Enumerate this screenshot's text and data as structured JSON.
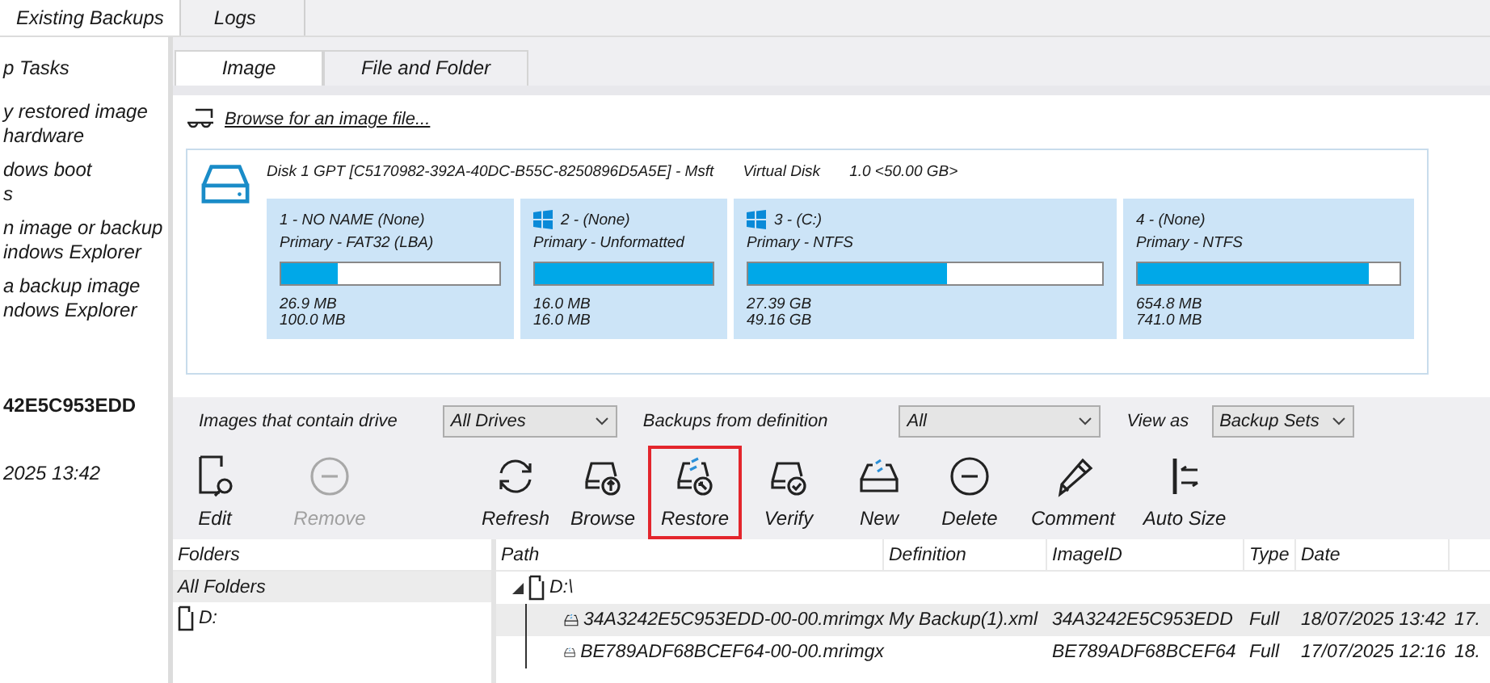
{
  "top_tabs": [
    {
      "label": "Existing Backups",
      "selected": true
    },
    {
      "label": "Logs",
      "selected": false
    }
  ],
  "left_panel": {
    "heading": "p Tasks",
    "tasks": [
      {
        "lines": [
          "y restored image",
          "hardware"
        ]
      },
      {
        "lines": [
          "dows boot",
          "s"
        ]
      },
      {
        "lines": [
          "n image or backup",
          "indows Explorer"
        ]
      },
      {
        "lines": [
          "a backup image",
          "ndows Explorer"
        ]
      }
    ],
    "image_id": "42E5C953EDD",
    "date": "2025 13:42"
  },
  "sub_tabs": [
    {
      "label": "Image",
      "selected": true
    },
    {
      "label": "File and Folder",
      "selected": false
    }
  ],
  "browse_link": "Browse for an image file...",
  "disk": {
    "title": "Disk 1 GPT [C5170982-392A-40DC-B55C-8250896D5A5E] - Msft",
    "type": "Virtual Disk",
    "size": "1.0  <50.00 GB>",
    "partitions": [
      {
        "name": "1 - NO NAME (None)",
        "fs": "Primary - FAT32 (LBA)",
        "os_icon": false,
        "level": 0.26,
        "used": "26.9 MB",
        "total": "100.0 MB"
      },
      {
        "name": "2 -  (None)",
        "fs": "Primary - Unformatted",
        "os_icon": true,
        "level": 1,
        "used": "16.0 MB",
        "total": "16.0 MB"
      },
      {
        "name": "3 -  (C:)",
        "fs": "Primary - NTFS",
        "os_icon": true,
        "level": 0.56,
        "used": "27.39 GB",
        "total": "49.16 GB"
      },
      {
        "name": "4 -  (None)",
        "fs": "Primary - NTFS",
        "os_icon": false,
        "level": 0.88,
        "used": "654.8 MB",
        "total": "741.0 MB"
      }
    ]
  },
  "filters": [
    {
      "label": "Images that contain drive",
      "value": "All Drives"
    },
    {
      "label": "Backups from definition",
      "value": "All"
    },
    {
      "label": "View as",
      "value": "Backup Sets"
    }
  ],
  "toolbar": [
    {
      "kind": "edit",
      "label": "Edit",
      "disabled": false,
      "highlighted": false
    },
    {
      "kind": "remove",
      "label": "Remove",
      "disabled": true,
      "highlighted": false
    },
    {
      "kind": "refresh",
      "label": "Refresh",
      "disabled": false,
      "highlighted": false
    },
    {
      "kind": "browse",
      "label": "Browse",
      "disabled": false,
      "highlighted": false
    },
    {
      "kind": "restore",
      "label": "Restore",
      "disabled": false,
      "highlighted": true
    },
    {
      "kind": "verify",
      "label": "Verify",
      "disabled": false,
      "highlighted": false
    },
    {
      "kind": "new",
      "label": "New",
      "disabled": false,
      "highlighted": false
    },
    {
      "kind": "delete",
      "label": "Delete",
      "disabled": false,
      "highlighted": false
    },
    {
      "kind": "comment",
      "label": "Comment",
      "disabled": false,
      "highlighted": false
    },
    {
      "kind": "autosize",
      "label": "Auto Size",
      "disabled": false,
      "highlighted": false
    }
  ],
  "folders": {
    "heading": "Folders",
    "items": [
      {
        "label": "All Folders",
        "selected": true,
        "kind": "all"
      },
      {
        "label": "D:",
        "selected": false,
        "kind": "drive"
      }
    ]
  },
  "backups": {
    "columns": [
      "Path",
      "Definition",
      "ImageID",
      "Type",
      "Date"
    ],
    "tree": {
      "label": "D:\\",
      "expanded": true,
      "children": [
        {
          "cells": [
            "34A3242E5C953EDD-00-00.mrimgx",
            "My Backup(1).xml",
            "34A3242E5C953EDD",
            "Full",
            "18/07/2025 13:42",
            "17."
          ],
          "selected": true
        },
        {
          "cells": [
            "BE789ADF68BCEF64-00-00.mrimgx",
            "",
            "BE789ADF68BCEF64",
            "Full",
            "17/07/2025 12:16",
            "18."
          ],
          "selected": false
        }
      ]
    }
  }
}
